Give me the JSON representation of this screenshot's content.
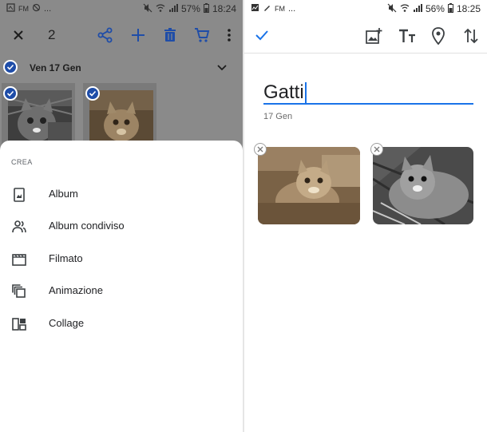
{
  "left": {
    "status": {
      "carrier": "FM",
      "extra": "...",
      "battery": "57%",
      "time": "18:24"
    },
    "toolbar": {
      "selected_count": "2"
    },
    "date_header": "Ven 17 Gen",
    "sheet": {
      "title": "CREA",
      "items": [
        {
          "label": "Album",
          "icon": "album-icon"
        },
        {
          "label": "Album condiviso",
          "icon": "shared-album-icon"
        },
        {
          "label": "Filmato",
          "icon": "movie-icon"
        },
        {
          "label": "Animazione",
          "icon": "animation-icon"
        },
        {
          "label": "Collage",
          "icon": "collage-icon"
        }
      ]
    }
  },
  "right": {
    "status": {
      "carrier": "FM",
      "extra": "...",
      "battery": "56%",
      "time": "18:25"
    },
    "album": {
      "title": "Gatti",
      "date": "17 Gen"
    },
    "colors": {
      "accent": "#1a73e8",
      "check": "#1f4da8"
    }
  }
}
